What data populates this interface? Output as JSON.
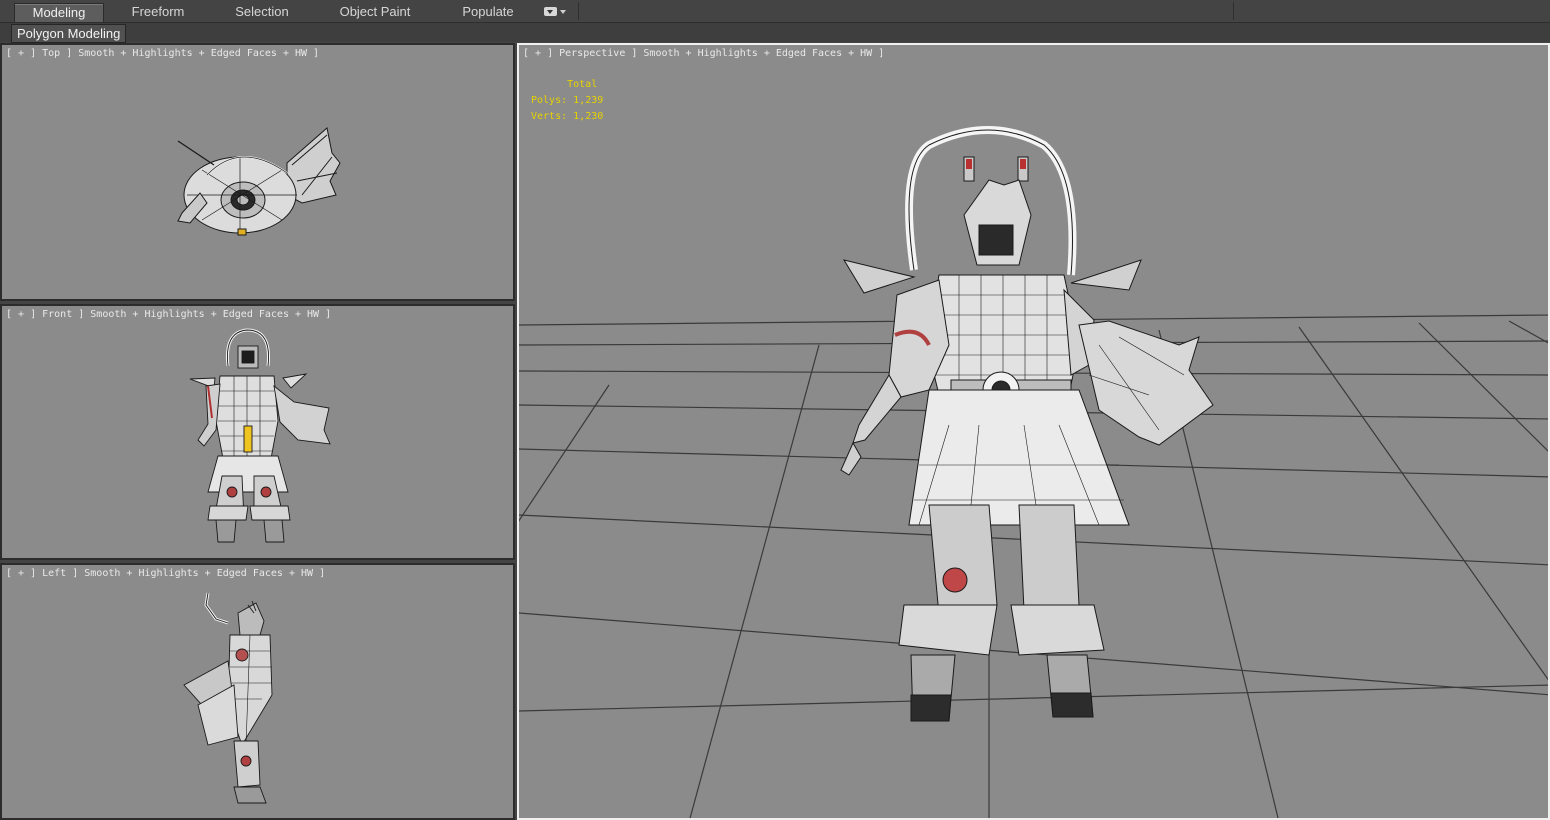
{
  "tabs": [
    {
      "label": "Modeling",
      "active": true
    },
    {
      "label": "Freeform",
      "active": false
    },
    {
      "label": "Selection",
      "active": false
    },
    {
      "label": "Object Paint",
      "active": false
    },
    {
      "label": "Populate",
      "active": false
    }
  ],
  "ribbon_panel": {
    "label": "Polygon Modeling"
  },
  "viewports": {
    "top": {
      "label": "[ + ] Top ] Smooth + Highlights + Edged Faces + HW ]"
    },
    "front": {
      "label": "[ + ] Front ] Smooth + Highlights + Edged Faces + HW ]"
    },
    "left": {
      "label": "[ + ] Left ] Smooth + Highlights + Edged Faces + HW ]"
    },
    "perspective": {
      "label": "[ + ] Perspective ] Smooth + Highlights + Edged Faces + HW ]"
    }
  },
  "stats": {
    "header": "Total",
    "polys_label": "Polys:",
    "polys_value": "1,239",
    "verts_label": "Verts:",
    "verts_value": "1,230"
  },
  "colors": {
    "viewport_bg": "#8b8b8b",
    "stats_text": "#e6d200",
    "active_border": "#f0f0f0"
  }
}
